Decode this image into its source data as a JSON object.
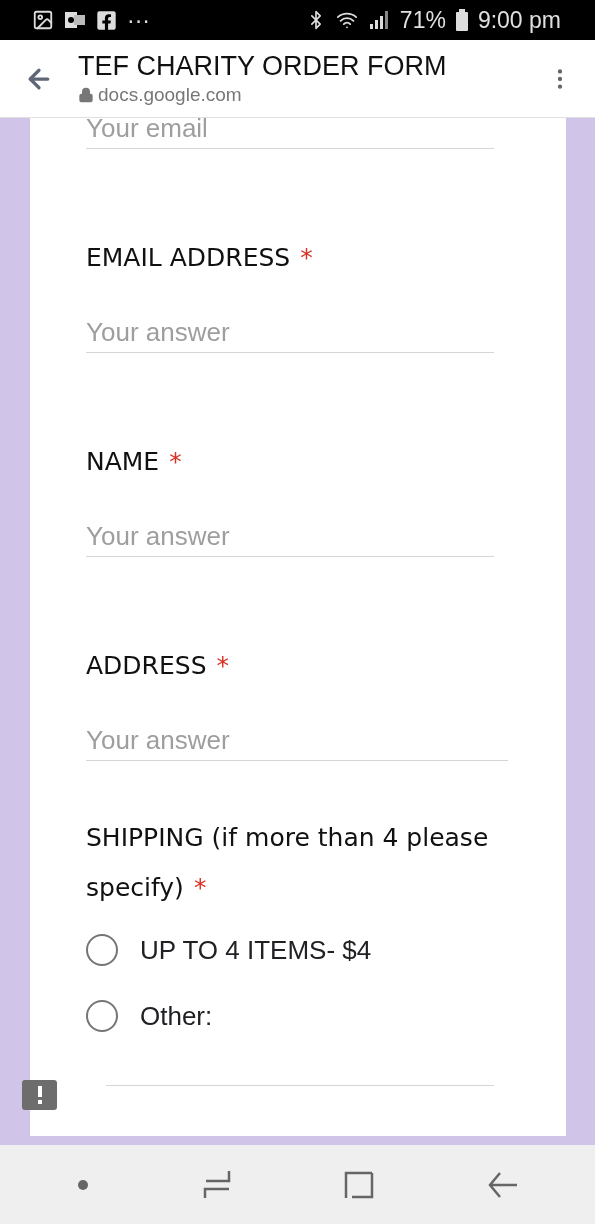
{
  "status_bar": {
    "battery": "71%",
    "time": "9:00 pm",
    "more": "···"
  },
  "browser": {
    "title": "TEF CHARITY ORDER FORM",
    "url": "docs.google.com"
  },
  "form": {
    "partial_field": {
      "placeholder": "Your email"
    },
    "questions": [
      {
        "kind": "text",
        "title": "EMAIL ADDRESS",
        "required_mark": "*",
        "placeholder": "Your answer",
        "wide": false
      },
      {
        "kind": "text",
        "title": "NAME",
        "required_mark": "*",
        "placeholder": "Your answer",
        "wide": false
      },
      {
        "kind": "text",
        "title": "ADDRESS",
        "required_mark": "*",
        "placeholder": "Your answer",
        "wide": true
      },
      {
        "kind": "choice",
        "title": "SHIPPING (if more than 4 please specify)",
        "required_mark": "*",
        "options": [
          {
            "kind": "option",
            "label": "UP TO 4 ITEMS- $4",
            "selected": false
          },
          {
            "kind": "other",
            "label": "Other:",
            "selected": false
          }
        ]
      }
    ]
  }
}
